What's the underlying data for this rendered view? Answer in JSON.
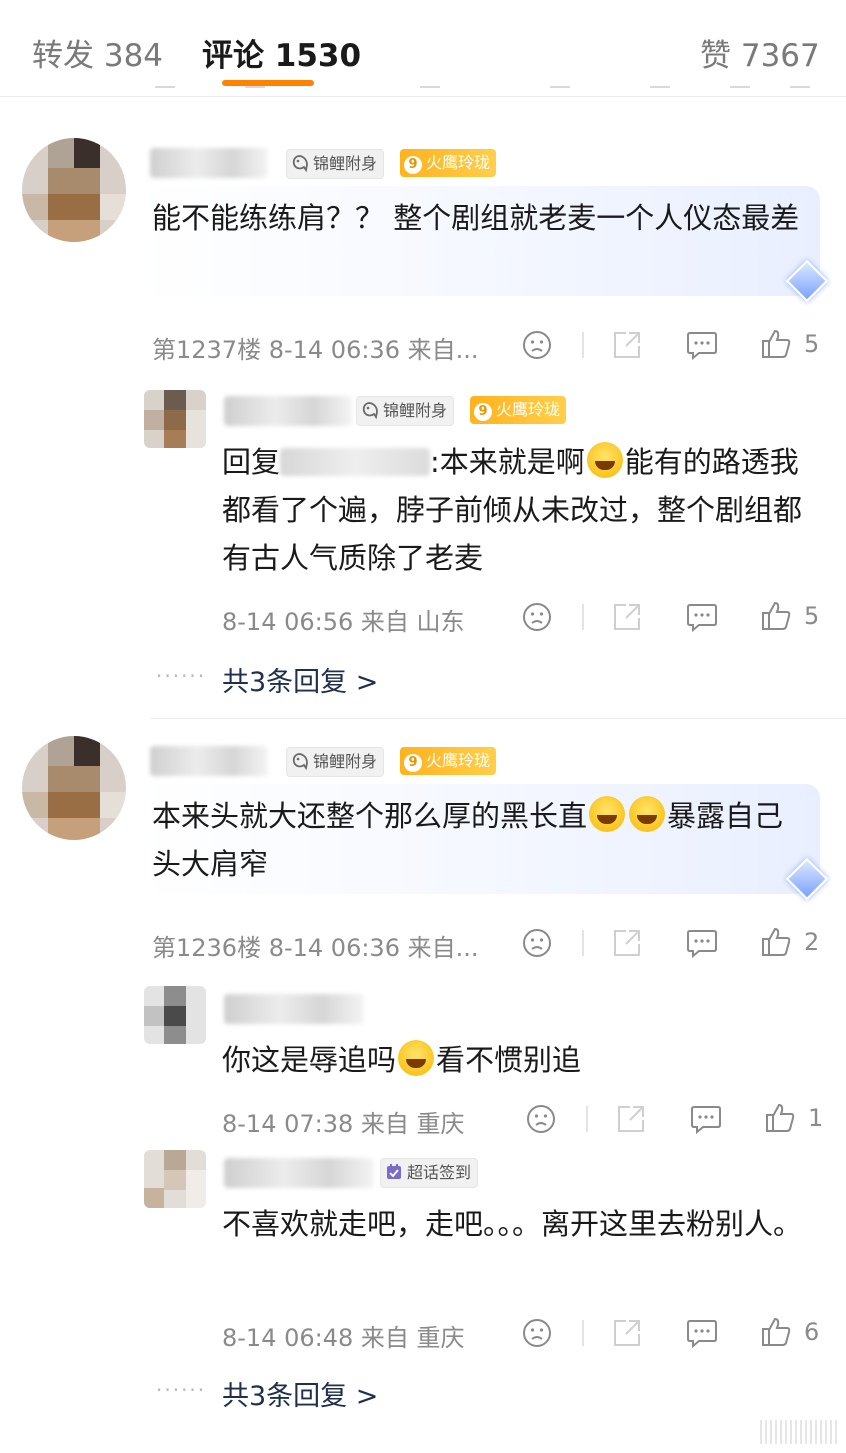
{
  "tabs": {
    "repost": "转发 384",
    "comments": "评论 1530",
    "likes": "赞 7367"
  },
  "badges": {
    "koi": "锦鲤附身",
    "level": "9",
    "fire": "火鹰玲珑",
    "checkin": "超话签到"
  },
  "comments": [
    {
      "text": "能不能练练肩？？ 整个剧组就老麦一个人仪态最差",
      "meta": "第1237楼 8-14 06:36 来自...",
      "likes": "5",
      "reply": {
        "prefix": "回复",
        "text": ":本来就是啊",
        "text2": "能有的路透我都看了个遍，脖子前倾从未改过，整个剧组都有古人气质除了老麦",
        "meta": "8-14 06:56 来自 山东",
        "likes": "5"
      },
      "more": "共3条回复 >"
    },
    {
      "text": "本来头就大还整个那么厚的黑长直",
      "text2": "暴露自己头大肩窄",
      "meta": "第1236楼 8-14 06:36 来自...",
      "likes": "2",
      "replies": [
        {
          "text": "你这是辱追吗",
          "text2": "看不惯别追",
          "meta": "8-14 07:38 来自 重庆",
          "likes": "1"
        },
        {
          "text": "不喜欢就走吧，走吧。。。离开这里去粉别人。",
          "meta": "8-14 06:48 来自 重庆",
          "likes": "6"
        }
      ],
      "more": "共3条回复 >"
    }
  ]
}
